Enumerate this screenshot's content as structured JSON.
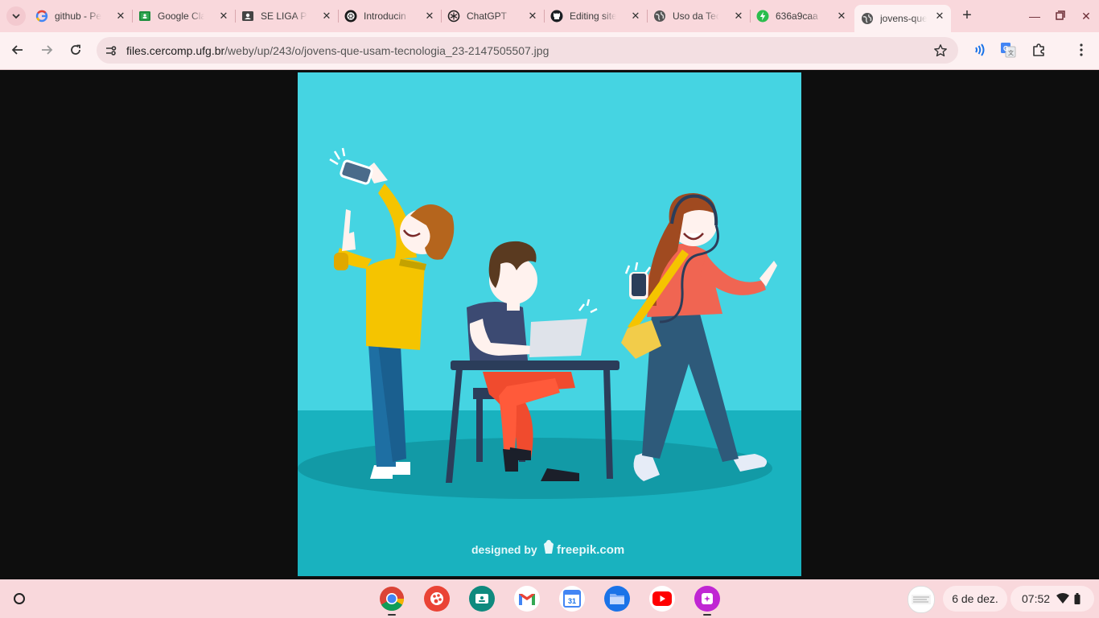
{
  "tabs": [
    {
      "title": "github - Pe",
      "icon": "google-icon"
    },
    {
      "title": "Google Cla",
      "icon": "google-classroom-icon"
    },
    {
      "title": "SE LIGA PE",
      "icon": "contact-card-icon"
    },
    {
      "title": "Introducin",
      "icon": "openai-icon"
    },
    {
      "title": "ChatGPT",
      "icon": "openai-icon"
    },
    {
      "title": "Editing site",
      "icon": "github-icon"
    },
    {
      "title": "Uso da Tec",
      "icon": "globe-icon"
    },
    {
      "title": "636a9caa",
      "icon": "lightning-icon"
    },
    {
      "title": "jovens-que",
      "icon": "globe-icon",
      "active": true
    }
  ],
  "omnibox": {
    "host": "files.cercomp.ufg.br",
    "path": "/weby/up/243/o/jovens-que-usam-tecnologia_23-2147505507.jpg"
  },
  "image": {
    "watermark_prefix": "designed by",
    "watermark_brand": "freepik.com"
  },
  "shelf": {
    "apps": [
      "chrome-icon",
      "canvas-icon",
      "classroom-icon",
      "gmail-icon",
      "calendar-icon",
      "files-icon",
      "youtube-icon",
      "screencast-icon"
    ],
    "calendar_day": "31",
    "date": "6 de dez.",
    "time": "07:52"
  },
  "colors": {
    "tabstrip": "#f9d8dc",
    "toolbar": "#fdf1f2",
    "image_bg": "#45d4e2",
    "floor": "#19b2bf"
  }
}
